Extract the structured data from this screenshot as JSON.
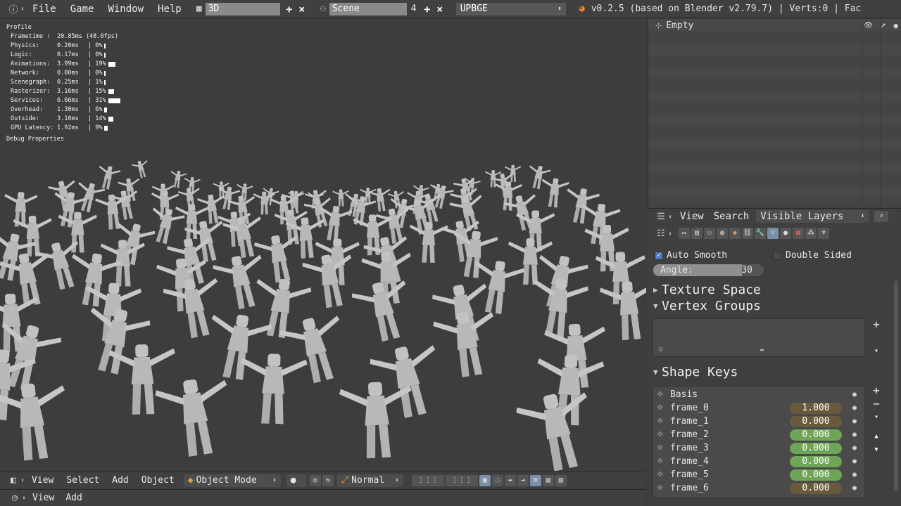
{
  "topbar": {
    "menus": [
      "File",
      "Game",
      "Window",
      "Help"
    ],
    "screen_layout": "3D",
    "scene_name": "Scene",
    "scene_count": "4",
    "engine": "UPBGE",
    "version_info": "v0.2.5 (based on Blender v2.79.7) | Verts:0 | Fac"
  },
  "profile": {
    "title": "Profile",
    "rows": [
      {
        "label": "Frametime :",
        "time": "20.85ms (48.0fps)",
        "pct": "",
        "bar": 0
      },
      {
        "label": "Physics:",
        "time": "0.20ms",
        "pct": "| 0%",
        "bar": 1
      },
      {
        "label": "Logic:",
        "time": "0.17ms",
        "pct": "| 0%",
        "bar": 1
      },
      {
        "label": "Animations:",
        "time": "3.99ms",
        "pct": "| 19%",
        "bar": 19
      },
      {
        "label": "Network:",
        "time": "0.00ms",
        "pct": "| 0%",
        "bar": 1
      },
      {
        "label": "Scenegraph:",
        "time": "0.25ms",
        "pct": "| 1%",
        "bar": 1
      },
      {
        "label": "Rasterizer:",
        "time": "3.16ms",
        "pct": "| 15%",
        "bar": 15
      },
      {
        "label": "Services:",
        "time": "6.66ms",
        "pct": "| 31%",
        "bar": 31
      },
      {
        "label": "Overhead:",
        "time": "1.30ms",
        "pct": "| 6%",
        "bar": 6
      },
      {
        "label": "Outside:",
        "time": "3.10ms",
        "pct": "| 14%",
        "bar": 14
      },
      {
        "label": "GPU Latency:",
        "time": "1.92ms",
        "pct": "| 9%",
        "bar": 9
      }
    ],
    "debug": "Debug Properties"
  },
  "viewport_header": {
    "menus": [
      "View",
      "Select",
      "Add",
      "Object"
    ],
    "mode": "Object Mode",
    "pivot": "Normal"
  },
  "timeline_header": {
    "menus": [
      "View",
      "Add"
    ]
  },
  "outliner": {
    "item": "Empty"
  },
  "properties_header": {
    "menus": [
      "View",
      "Search"
    ],
    "filter": "Visible Layers"
  },
  "normals": {
    "auto_smooth": "Auto Smooth",
    "double_sided": "Double Sided",
    "angle_label": "Angle:",
    "angle_value": "30"
  },
  "panels": {
    "texture_space": "Texture Space",
    "vertex_groups": "Vertex Groups",
    "shape_keys": "Shape Keys"
  },
  "shape_keys": [
    {
      "name": "Basis",
      "value": "",
      "green": false
    },
    {
      "name": "frame_0",
      "value": "1.000",
      "green": false
    },
    {
      "name": "frame_1",
      "value": "0.000",
      "green": false
    },
    {
      "name": "frame_2",
      "value": "0.000",
      "green": true
    },
    {
      "name": "frame_3",
      "value": "0.000",
      "green": true
    },
    {
      "name": "frame_4",
      "value": "0.000",
      "green": true
    },
    {
      "name": "frame_5",
      "value": "0.000",
      "green": true
    },
    {
      "name": "frame_6",
      "value": "0.000",
      "green": false
    }
  ]
}
